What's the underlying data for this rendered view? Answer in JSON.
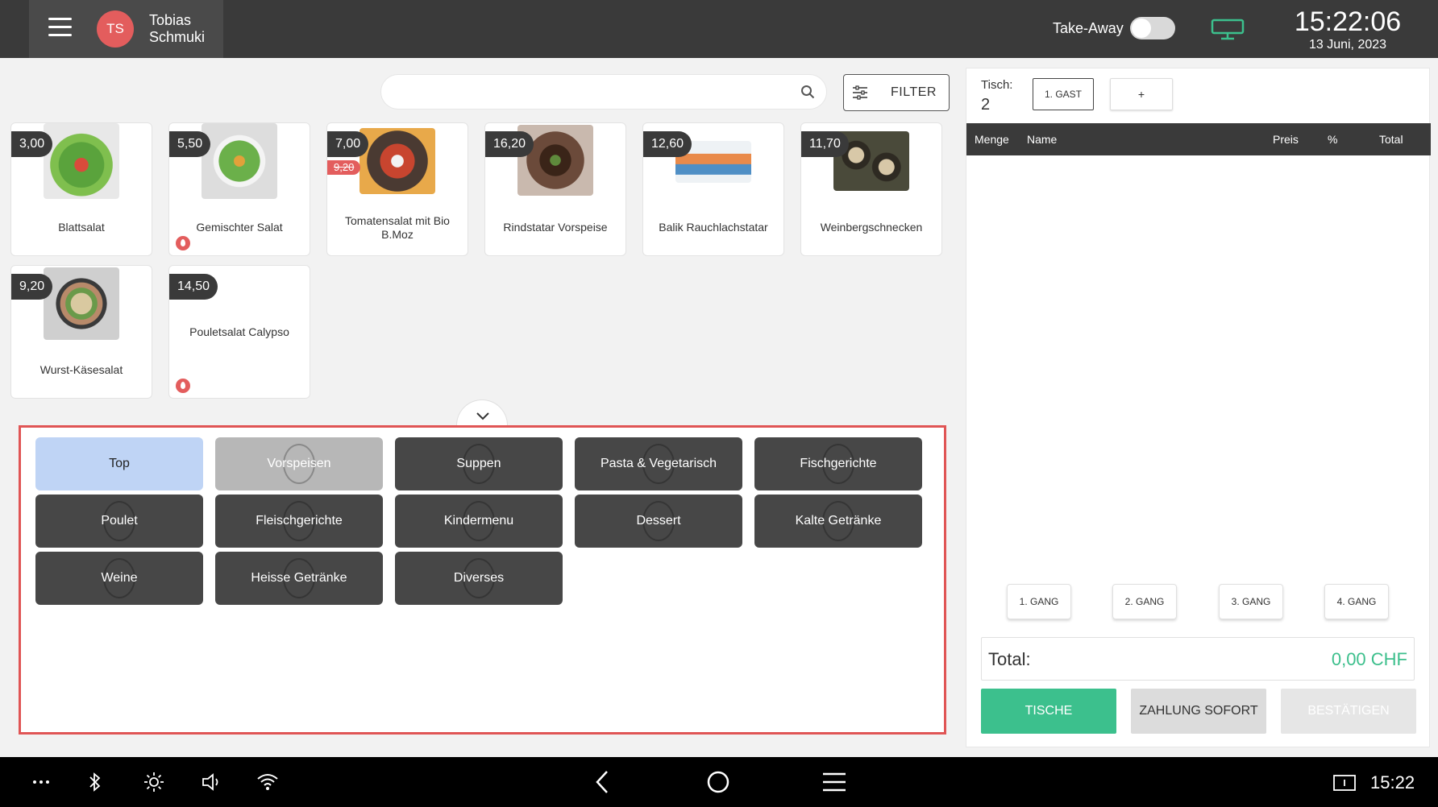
{
  "header": {
    "avatar_initials": "TS",
    "user_name": "Tobias Schmuki",
    "takeaway_label": "Take-Away",
    "time": "15:22:06",
    "date": "13 Juni, 2023"
  },
  "search": {
    "placeholder": ""
  },
  "filter": {
    "label": "FILTER"
  },
  "products": [
    {
      "name": "Blattsalat",
      "price": "3,00"
    },
    {
      "name": "Gemischter Salat",
      "price": "5,50",
      "hot": true
    },
    {
      "name": "Tomatensalat mit Bio B.Moz",
      "price": "7,00",
      "old_price": "9,20"
    },
    {
      "name": "Rindstatar Vorspeise",
      "price": "16,20"
    },
    {
      "name": "Balik Rauchlachstatar",
      "price": "12,60"
    },
    {
      "name": "Weinbergschnecken",
      "price": "11,70"
    },
    {
      "name": "Wurst-Käsesalat",
      "price": "9,20"
    },
    {
      "name": "Pouletsalat Calypso",
      "price": "14,50",
      "hot": true
    }
  ],
  "categories": [
    "Top",
    "Vorspeisen",
    "Suppen",
    "Pasta & Vegetarisch",
    "Fischgerichte",
    "Poulet",
    "Fleischgerichte",
    "Kindermenu",
    "Dessert",
    "Kalte Getränke",
    "Weine",
    "Heisse Getränke",
    "Diverses"
  ],
  "order": {
    "tisch_label": "Tisch:",
    "tisch_number": "2",
    "gast_label": "1. GAST",
    "plus_label": "+",
    "columns": [
      "Menge",
      "Name",
      "Preis",
      "%",
      "Total"
    ],
    "gang_buttons": [
      "1. GANG",
      "2. GANG",
      "3. GANG",
      "4. GANG"
    ],
    "total_label": "Total:",
    "total_value": "0,00 CHF",
    "actions": [
      "TISCHE",
      "ZAHLUNG SOFORT",
      "BESTÄTIGEN"
    ]
  },
  "navbar": {
    "time": "15:22"
  },
  "colors": {
    "accent_green": "#3cc08d",
    "badge_red": "#e35d5d",
    "dark": "#3a3a3a",
    "active_category": "#bfd4f5"
  }
}
